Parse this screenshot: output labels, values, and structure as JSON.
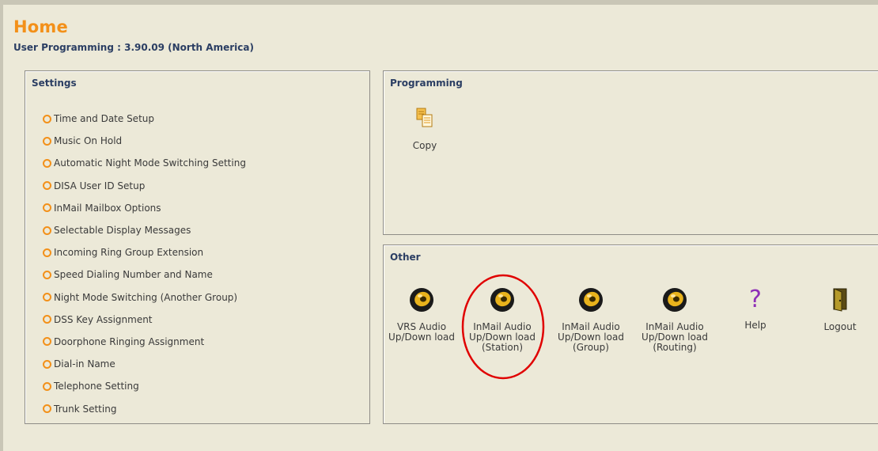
{
  "header": {
    "title": "Home",
    "subtitle": "User Programming : 3.90.09 (North America)"
  },
  "settings": {
    "title": "Settings",
    "items": [
      {
        "label": "Time and Date Setup"
      },
      {
        "label": "Music On Hold"
      },
      {
        "label": "Automatic Night Mode Switching Setting"
      },
      {
        "label": "DISA User ID Setup"
      },
      {
        "label": "InMail Mailbox Options"
      },
      {
        "label": "Selectable Display Messages"
      },
      {
        "label": "Incoming Ring Group Extension"
      },
      {
        "label": "Speed Dialing Number and Name"
      },
      {
        "label": "Night Mode Switching (Another Group)"
      },
      {
        "label": "DSS Key Assignment"
      },
      {
        "label": "Doorphone Ringing Assignment"
      },
      {
        "label": "Dial-in Name"
      },
      {
        "label": "Telephone Setting"
      },
      {
        "label": "Trunk Setting"
      }
    ]
  },
  "programming": {
    "title": "Programming",
    "copy_label": "Copy",
    "copy_icon": "copy-icon"
  },
  "other": {
    "title": "Other",
    "tools": [
      {
        "label": "VRS Audio\nUp/Down load",
        "icon": "speaker-icon"
      },
      {
        "label": "InMail Audio\nUp/Down load\n(Station)",
        "icon": "speaker-icon",
        "highlighted": true
      },
      {
        "label": "InMail Audio\nUp/Down load\n(Group)",
        "icon": "speaker-icon"
      },
      {
        "label": "InMail Audio\nUp/Down load\n(Routing)",
        "icon": "speaker-icon"
      },
      {
        "label": "Help",
        "icon": "help-icon"
      },
      {
        "label": "Logout",
        "icon": "logout-icon"
      }
    ]
  },
  "colors": {
    "background": "#ece9d8",
    "title_orange": "#f39019",
    "heading_navy": "#2b3e63",
    "highlight_red": "#e00000",
    "help_purple": "#8e2fb7"
  }
}
